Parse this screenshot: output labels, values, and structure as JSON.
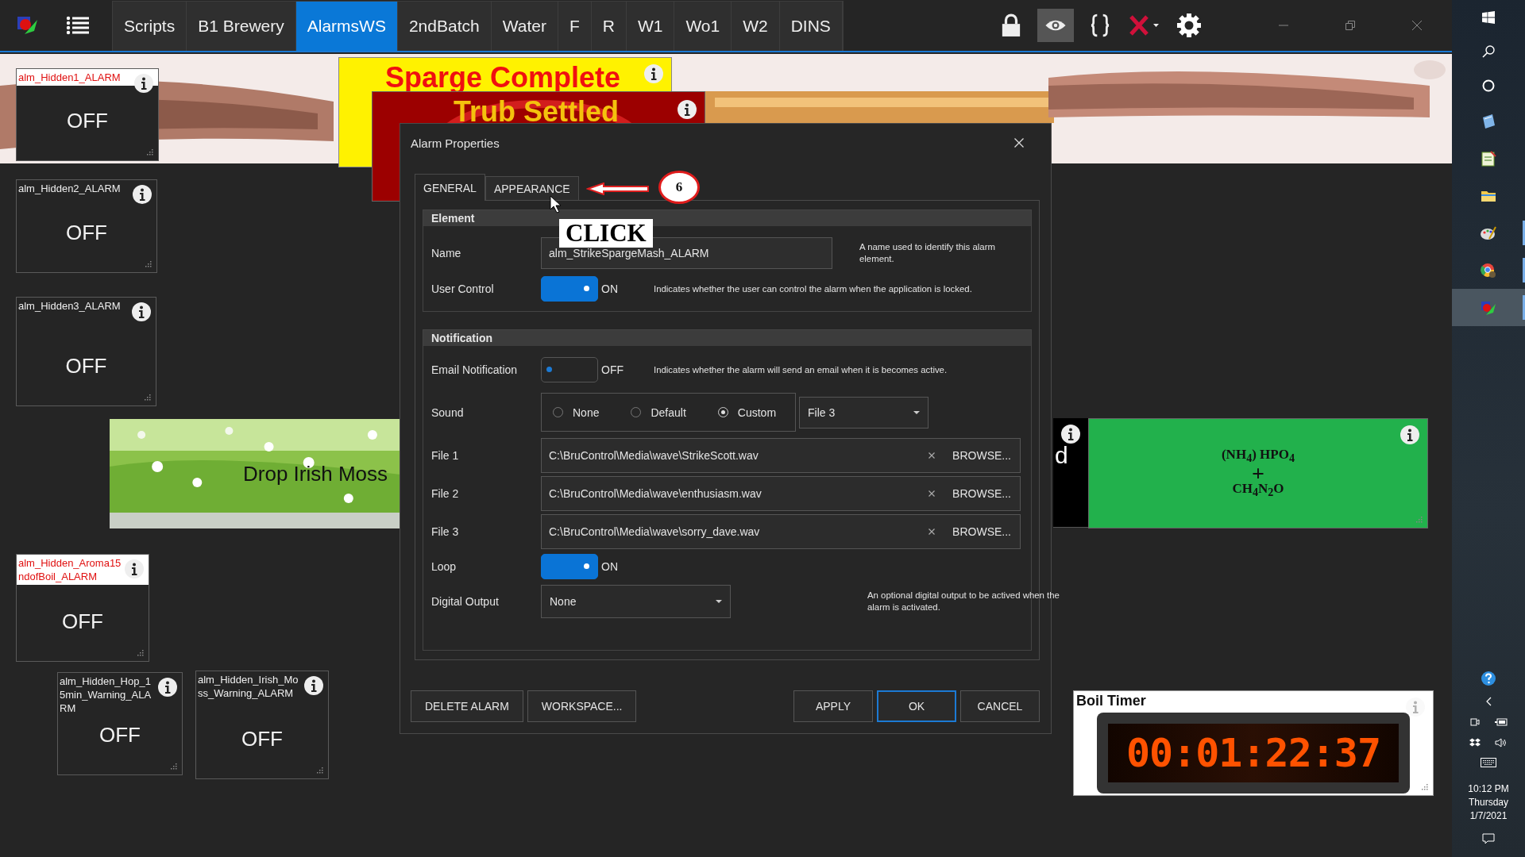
{
  "titlebar": {
    "tabs": [
      {
        "label": "Scripts",
        "selected": false
      },
      {
        "label": "B1 Brewery",
        "selected": false
      },
      {
        "label": "AlarmsWS",
        "selected": true
      },
      {
        "label": "2ndBatch",
        "selected": false
      },
      {
        "label": "Water",
        "selected": false
      },
      {
        "label": "F",
        "selected": false
      },
      {
        "label": "R",
        "selected": false
      },
      {
        "label": "W1",
        "selected": false
      },
      {
        "label": "Wo1",
        "selected": false
      },
      {
        "label": "W2",
        "selected": false
      },
      {
        "label": "DINS",
        "selected": false
      }
    ],
    "toolbar": [
      {
        "kind": "lock",
        "selected": false
      },
      {
        "kind": "view",
        "selected": true
      },
      {
        "kind": "script",
        "selected": false
      },
      {
        "kind": "stop",
        "selected": false
      },
      {
        "kind": "settings",
        "selected": false
      }
    ]
  },
  "workspace": {
    "alarm_tiles": [
      {
        "name": "alm_Hidden1_ALARM",
        "value": "OFF",
        "alerting": true
      },
      {
        "name": "alm_Hidden2_ALARM",
        "value": "OFF",
        "alerting": false
      },
      {
        "name": "alm_Hidden3_ALARM",
        "value": "OFF",
        "alerting": false
      },
      {
        "name": "alm_Hidden_Aroma15ndofBoil_ALARM",
        "value": "OFF",
        "alerting": true
      },
      {
        "name": "alm_Hidden_Hop_15min_Warning_ALARM",
        "value": "OFF",
        "alerting": false
      },
      {
        "name": "alm_Hidden_Irish_Moss_Warning_ALARM",
        "value": "OFF",
        "alerting": false
      }
    ],
    "sparge_banner": {
      "text": "Sparge Complete"
    },
    "trub_banner": {
      "text": "Trub Settled"
    },
    "moss_image": {
      "kind": "picture",
      "caption": "Drop Irish Moss"
    },
    "partial_tile": {
      "text": "d"
    },
    "formula_tile": {
      "lines": [
        "(NH$_{4}$) HPO$_{4}$",
        "+",
        "CH$_{4}$N$_{2}$O"
      ]
    },
    "boil_timer": {
      "title": "Boil Timer",
      "display": "00:01:22:37"
    }
  },
  "dialog": {
    "title": "Alarm Properties",
    "tabs": [
      {
        "label": "GENERAL",
        "selected": true
      },
      {
        "label": "APPEARANCE",
        "selected": false
      }
    ],
    "element": {
      "heading": "Element",
      "name": {
        "label": "Name",
        "value": "alm_StrikeSpargeMash_ALARM",
        "help": "A name used to identify this alarm element."
      },
      "user_control": {
        "label": "User Control",
        "on": true,
        "state_text": "ON",
        "help": "Indicates whether the user can control the alarm when the application is locked."
      }
    },
    "notification": {
      "heading": "Notification",
      "email": {
        "label": "Email Notification",
        "on": false,
        "state_text": "OFF",
        "help": "Indicates whether the alarm will send an email when it is becomes active."
      },
      "sound": {
        "label": "Sound",
        "options": [
          {
            "label": "None",
            "selected": false
          },
          {
            "label": "Default",
            "selected": false
          },
          {
            "label": "Custom",
            "selected": true
          }
        ],
        "file_choice": "File 3"
      },
      "files": [
        {
          "label": "File 1",
          "path": "C:\\BruControl\\Media\\wave\\StrikeScott.wav",
          "browse": "BROWSE..."
        },
        {
          "label": "File 2",
          "path": "C:\\BruControl\\Media\\wave\\enthusiasm.wav",
          "browse": "BROWSE..."
        },
        {
          "label": "File 3",
          "path": "C:\\BruControl\\Media\\wave\\sorry_dave.wav",
          "browse": "BROWSE..."
        }
      ],
      "loop": {
        "label": "Loop",
        "on": true,
        "state_text": "ON"
      },
      "digital_output": {
        "label": "Digital Output",
        "value": "None",
        "help": "An optional digital output to be actived when the alarm is activated."
      }
    },
    "left_buttons": [
      {
        "label": "DELETE ALARM",
        "default": false
      },
      {
        "label": "WORKSPACE...",
        "default": false
      }
    ],
    "right_buttons": [
      {
        "label": "APPLY",
        "default": false
      },
      {
        "label": "OK",
        "default": true
      },
      {
        "label": "CANCEL",
        "default": false
      }
    ]
  },
  "annotation": {
    "step": "6",
    "callout": "CLICK"
  },
  "taskbar": {
    "apps": [
      {
        "kind": "notepad",
        "selected": false,
        "running": false
      },
      {
        "kind": "notebook",
        "selected": false,
        "running": false
      },
      {
        "kind": "folder",
        "selected": false,
        "running": false
      },
      {
        "kind": "palette",
        "selected": false,
        "running": true
      },
      {
        "kind": "browser",
        "selected": false,
        "running": true
      },
      {
        "kind": "logo",
        "selected": true,
        "running": true
      }
    ],
    "clock": {
      "time": "10:12 PM",
      "day": "Thursday",
      "date": "1/7/2021"
    }
  }
}
